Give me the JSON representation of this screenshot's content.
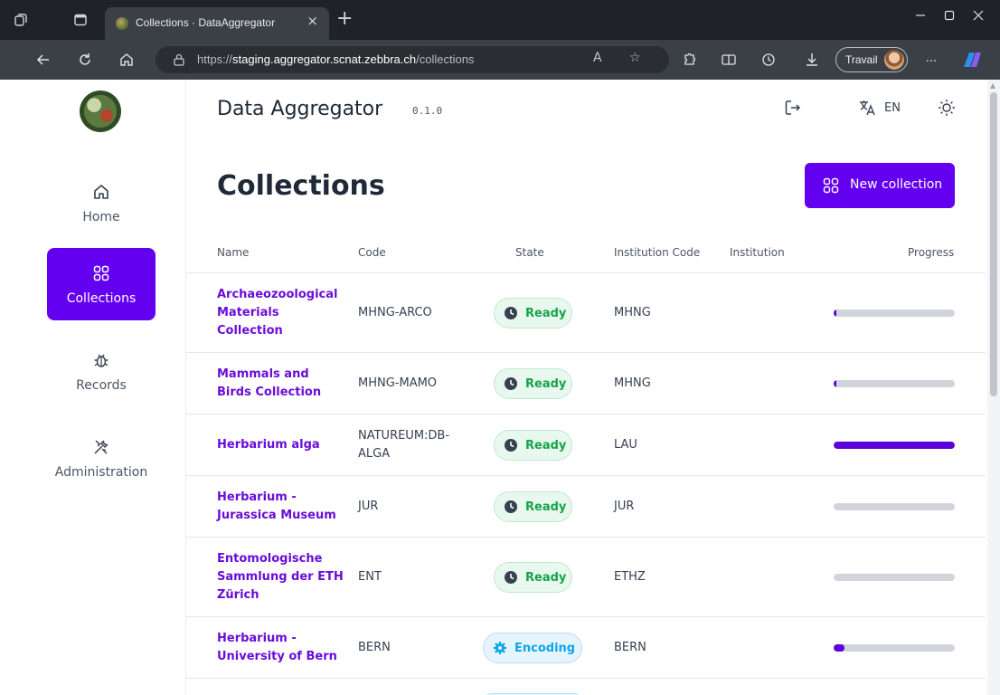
{
  "browser": {
    "tab_title": "Collections · DataAggregator",
    "tab_close": "×",
    "new_tab": "+",
    "url_scheme": "https://",
    "url_host": "staging.aggregator.scnat.zebbra.ch",
    "url_path": "/collections",
    "profile_label": "Travail",
    "more": "···"
  },
  "app": {
    "title": "Data Aggregator",
    "version": "0.1.0",
    "language": "EN"
  },
  "sidebar": {
    "items": [
      {
        "label": "Home"
      },
      {
        "label": "Collections"
      },
      {
        "label": "Records"
      },
      {
        "label": "Administration"
      }
    ]
  },
  "page": {
    "title": "Collections",
    "new_button": "New collection"
  },
  "table": {
    "columns": [
      "Name",
      "Code",
      "State",
      "Institution Code",
      "Institution",
      "Progress"
    ],
    "rows": [
      {
        "name": "Archaeozoological Materials Collection",
        "code": "MHNG-ARCO",
        "state": "Ready",
        "institution_code": "MHNG",
        "institution": "",
        "progress": 0.01
      },
      {
        "name": "Mammals and Birds Collection",
        "code": "MHNG-MAMO",
        "state": "Ready",
        "institution_code": "MHNG",
        "institution": "",
        "progress": 0.01
      },
      {
        "name": "Herbarium alga",
        "code": "NATUREUM:DB-ALGA",
        "state": "Ready",
        "institution_code": "LAU",
        "institution": "",
        "progress": 1.0
      },
      {
        "name": "Herbarium - Jurassica Museum",
        "code": "JUR",
        "state": "Ready",
        "institution_code": "JUR",
        "institution": "",
        "progress": 0.0
      },
      {
        "name": "Entomologische Sammlung der ETH Zürich",
        "code": "ENT",
        "state": "Ready",
        "institution_code": "ETHZ",
        "institution": "",
        "progress": 0.0
      },
      {
        "name": "Herbarium - University of Bern",
        "code": "BERN",
        "state": "Encoding",
        "institution_code": "BERN",
        "institution": "",
        "progress": 0.09
      }
    ]
  },
  "colors": {
    "accent": "#6400f0",
    "ready": "#16a34a",
    "encoding": "#0ea5e9"
  }
}
